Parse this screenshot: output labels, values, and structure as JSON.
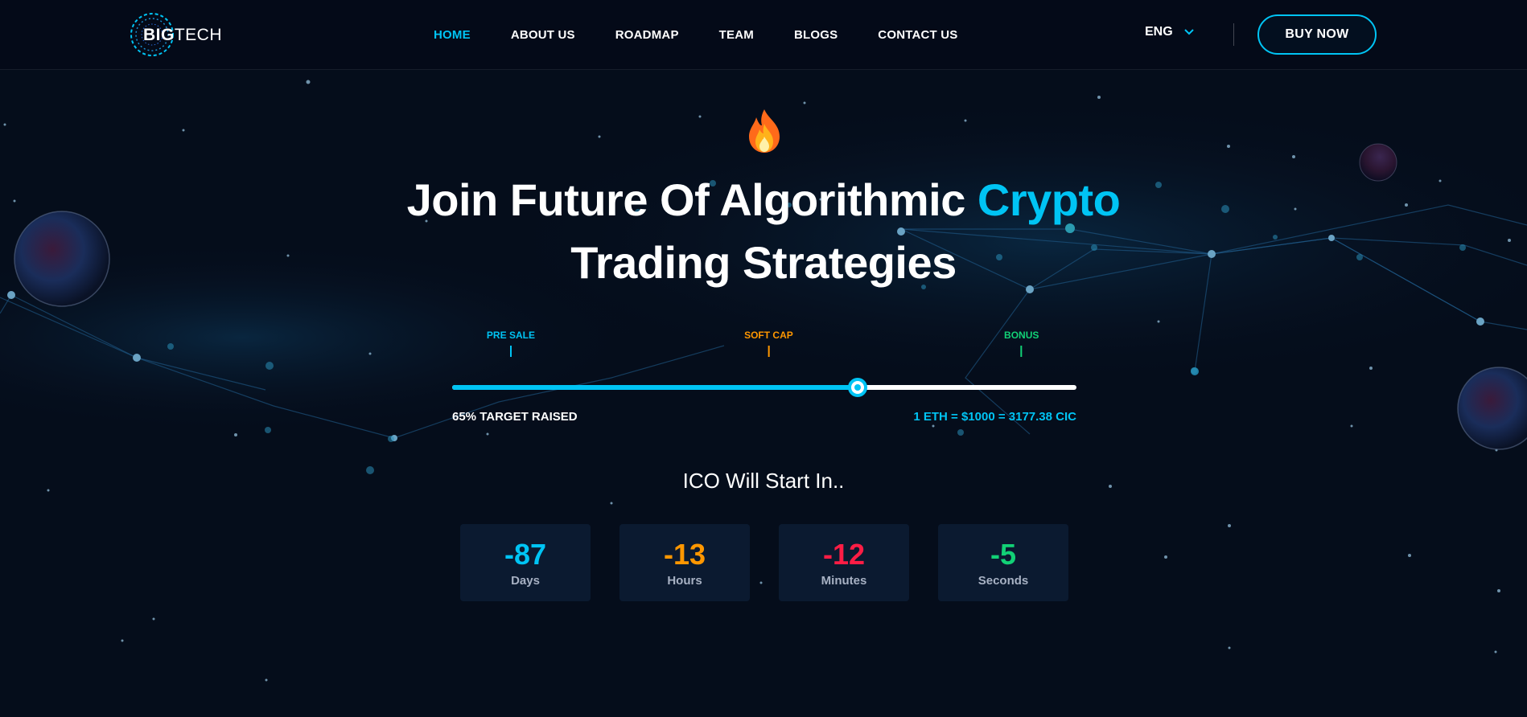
{
  "header": {
    "logo": {
      "bold": "BIG",
      "thin": "TECH"
    },
    "nav": [
      {
        "label": "HOME",
        "active": true
      },
      {
        "label": "ABOUT US",
        "active": false
      },
      {
        "label": "ROADMAP",
        "active": false
      },
      {
        "label": "TEAM",
        "active": false
      },
      {
        "label": "BLOGS",
        "active": false
      },
      {
        "label": "CONTACT US",
        "active": false
      }
    ],
    "language": "ENG",
    "buy_button": "BUY NOW"
  },
  "hero": {
    "icon": "fire-icon",
    "title_line1": "Join Future Of Algorithmic ",
    "title_highlight": "Crypto",
    "title_line2": "Trading Strategies"
  },
  "progress": {
    "markers": [
      {
        "label": "PRE SALE",
        "color": "#00c4f4",
        "position": 0.094
      },
      {
        "label": "SOFT CAP",
        "color": "#ff9700",
        "position": 0.507
      },
      {
        "label": "BONUS",
        "color": "#12d176",
        "position": 0.912
      }
    ],
    "fill_fraction": 0.65,
    "raised_text": "65% TARGET RAISED",
    "rate_text": "1 ETH = $1000 = 3177.38 CIC"
  },
  "countdown": {
    "title": "ICO Will Start In..",
    "items": [
      {
        "value": "-87",
        "label": "Days",
        "color": "#00c4f4"
      },
      {
        "value": "-13",
        "label": "Hours",
        "color": "#ff9700"
      },
      {
        "value": "-12",
        "label": "Minutes",
        "color": "#ff1d45"
      },
      {
        "value": "-5",
        "label": "Seconds",
        "color": "#12d176"
      }
    ]
  },
  "colors": {
    "accent": "#00c4f4",
    "background": "#050d1b",
    "card": "#0b1a30"
  }
}
